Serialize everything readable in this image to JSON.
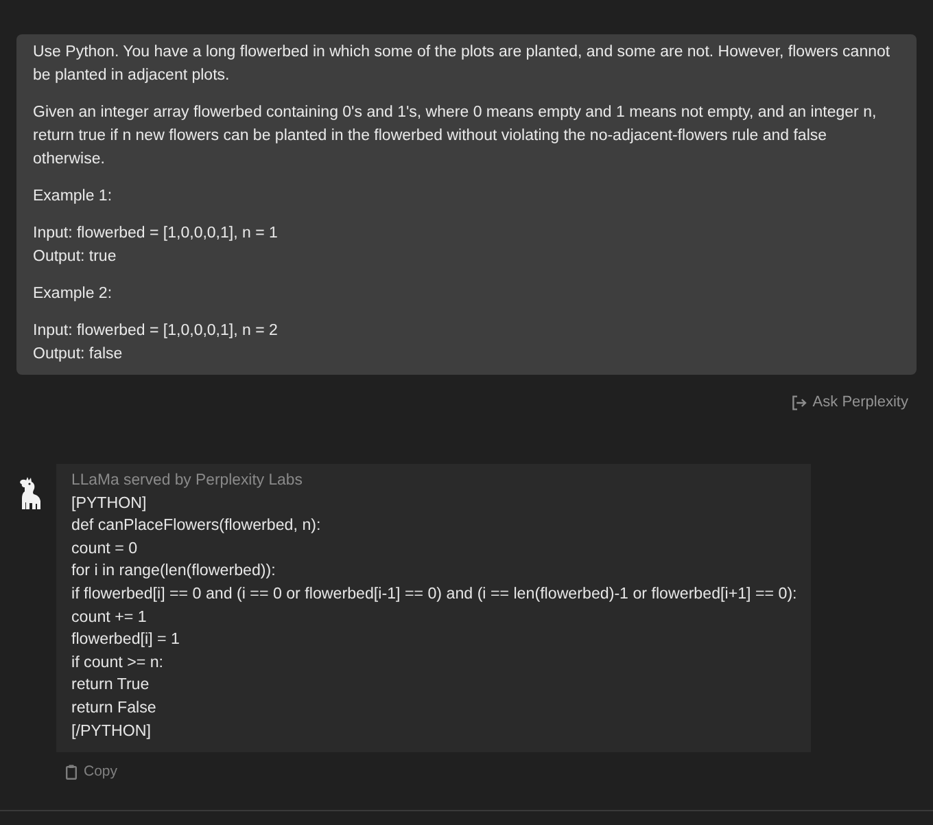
{
  "prompt": {
    "paragraphs": [
      [
        "Use Python. You have a long flowerbed in which some of the plots are planted, and some are not. However, flowers cannot be planted in adjacent plots."
      ],
      [
        "Given an integer array flowerbed containing 0's and 1's, where 0 means empty and 1 means not empty, and an integer n, return true if n new flowers can be planted in the flowerbed without violating the no-adjacent-flowers rule and false otherwise."
      ],
      [
        "Example 1:"
      ],
      [
        "Input: flowerbed = [1,0,0,0,1], n = 1",
        "Output: true"
      ],
      [
        "Example 2:"
      ],
      [
        "Input: flowerbed = [1,0,0,0,1], n = 2",
        "Output: false"
      ]
    ]
  },
  "ask_button": {
    "label": "Ask Perplexity"
  },
  "answer": {
    "source": "LLaMa served by Perplexity Labs",
    "code_lines": [
      "[PYTHON]",
      "def canPlaceFlowers(flowerbed, n):",
      "count = 0",
      "for i in range(len(flowerbed)):",
      "if flowerbed[i] == 0 and (i == 0 or flowerbed[i-1] == 0) and (i == len(flowerbed)-1 or flowerbed[i+1] == 0):",
      "count += 1",
      "flowerbed[i] = 1",
      "if count >= n:",
      "return True",
      "return False",
      "[/PYTHON]"
    ]
  },
  "copy_button": {
    "label": "Copy"
  }
}
